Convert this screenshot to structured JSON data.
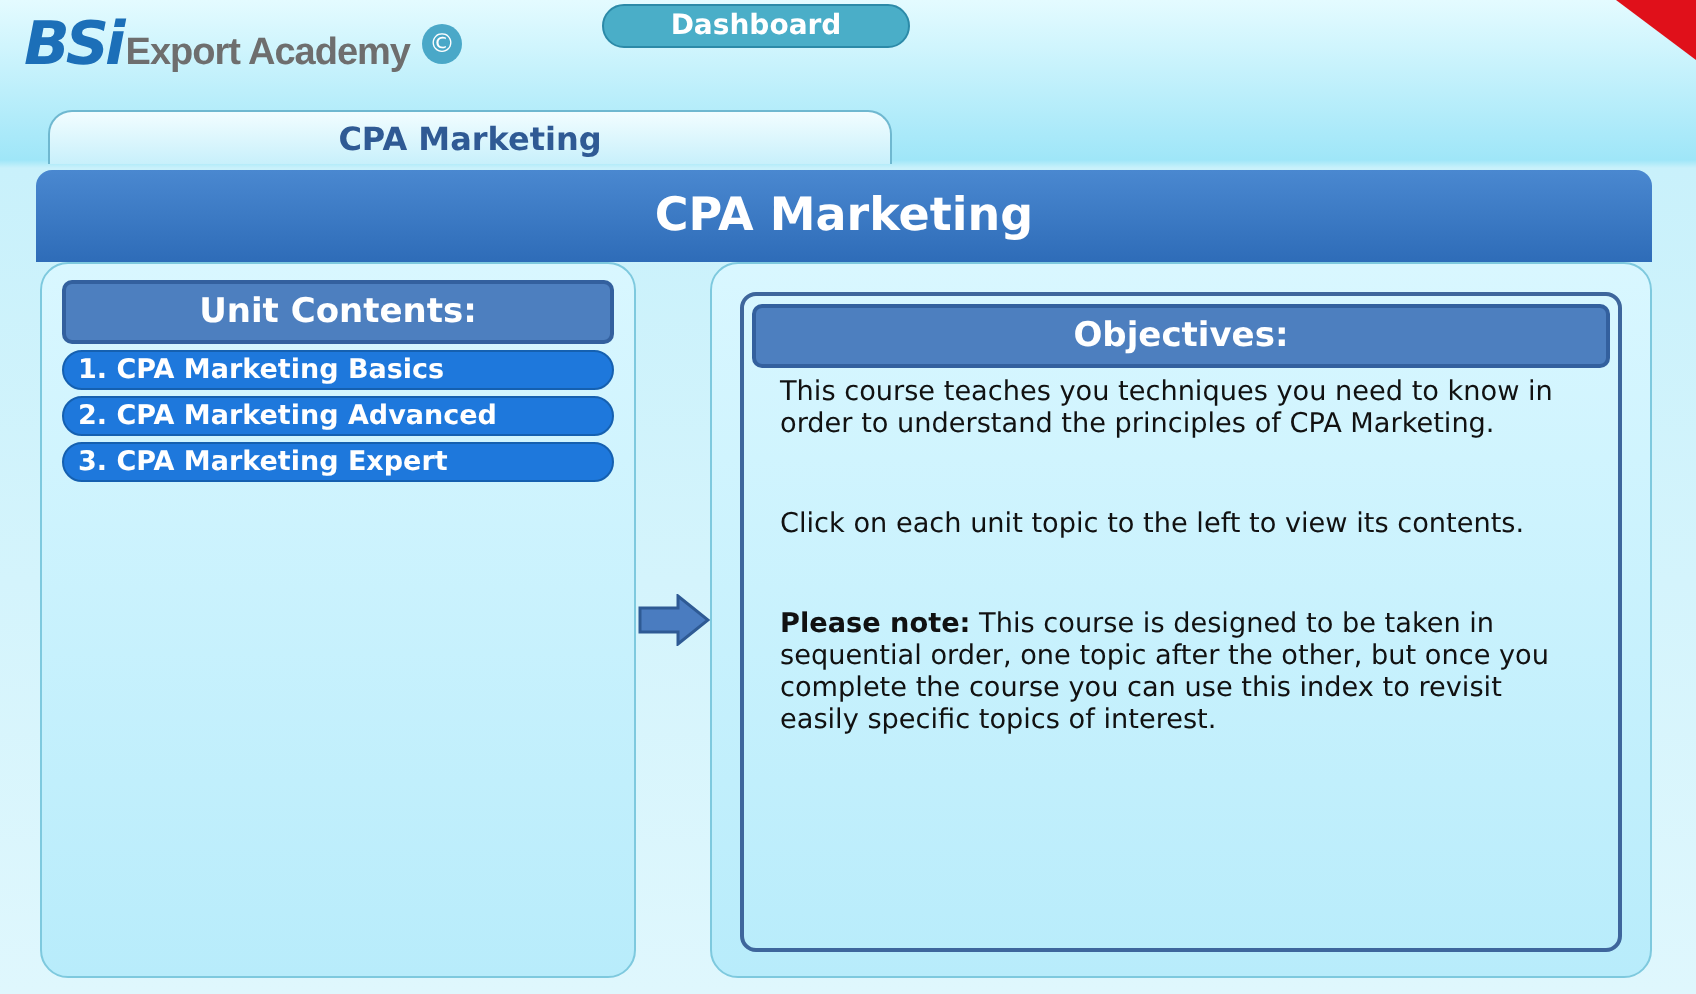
{
  "logo": {
    "mark": "BSi",
    "name": "Export Academy",
    "copyright": "©"
  },
  "dashboard_button": "Dashboard",
  "breadcrumb": "CPA Marketing",
  "title": "CPA Marketing",
  "unit_contents": {
    "heading": "Unit Contents:",
    "items": [
      "1. CPA Marketing Basics",
      "2. CPA Marketing Advanced",
      "3. CPA Marketing Expert"
    ]
  },
  "objectives": {
    "heading": "Objectives:",
    "paragraphs": [
      "This course teaches you techniques you need to know in order to understand the principles of CPA Marketing.",
      "Click on each unit topic to the left to view its contents.",
      "**Please note:** This course is designed to be taken in sequential order, one topic after the other, but once you complete the course you can use this index to revisit easily specific topics of interest."
    ]
  }
}
